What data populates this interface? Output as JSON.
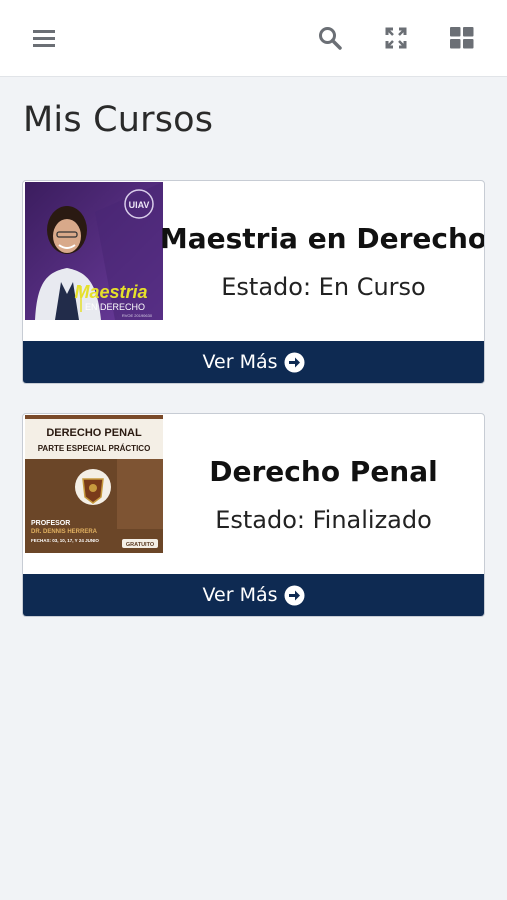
{
  "header": {
    "icons": [
      "menu-icon",
      "search-icon",
      "fullscreen-icon",
      "grid-icon"
    ]
  },
  "page": {
    "title": "Mis Cursos"
  },
  "courses": [
    {
      "name": "Maestria en Derecho",
      "status": "Estado: En Curso",
      "action": "Ver Más",
      "thumb": {
        "script_title": "Maestria",
        "subtitle": "EN DERECHO",
        "small": "RVOE 20190630",
        "seal": "UIAV"
      }
    },
    {
      "name": "Derecho Penal",
      "status": "Estado: Finalizado",
      "action": "Ver Más",
      "thumb": {
        "title1": "DERECHO PENAL",
        "title2": "PARTE ESPECIAL PRÁCTICO",
        "label": "PROFESOR",
        "teacher": "DR. DENNIS HERRERA",
        "dates": "FECHAS: 03, 10, 17, Y 24 JUNIO",
        "badge": "GRATUITO"
      }
    }
  ],
  "colors": {
    "footer": "#0e2a52",
    "accent_purple": "#5b2d8a",
    "accent_brown": "#5a3a22"
  }
}
